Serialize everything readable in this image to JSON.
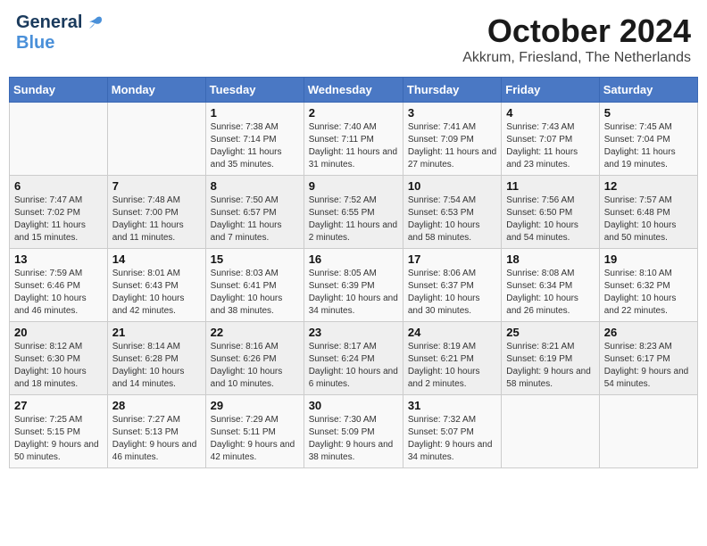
{
  "header": {
    "logo_general": "General",
    "logo_blue": "Blue",
    "main_title": "October 2024",
    "subtitle": "Akkrum, Friesland, The Netherlands"
  },
  "weekdays": [
    "Sunday",
    "Monday",
    "Tuesday",
    "Wednesday",
    "Thursday",
    "Friday",
    "Saturday"
  ],
  "weeks": [
    [
      {
        "day": "",
        "info": ""
      },
      {
        "day": "",
        "info": ""
      },
      {
        "day": "1",
        "info": "Sunrise: 7:38 AM\nSunset: 7:14 PM\nDaylight: 11 hours and 35 minutes."
      },
      {
        "day": "2",
        "info": "Sunrise: 7:40 AM\nSunset: 7:11 PM\nDaylight: 11 hours and 31 minutes."
      },
      {
        "day": "3",
        "info": "Sunrise: 7:41 AM\nSunset: 7:09 PM\nDaylight: 11 hours and 27 minutes."
      },
      {
        "day": "4",
        "info": "Sunrise: 7:43 AM\nSunset: 7:07 PM\nDaylight: 11 hours and 23 minutes."
      },
      {
        "day": "5",
        "info": "Sunrise: 7:45 AM\nSunset: 7:04 PM\nDaylight: 11 hours and 19 minutes."
      }
    ],
    [
      {
        "day": "6",
        "info": "Sunrise: 7:47 AM\nSunset: 7:02 PM\nDaylight: 11 hours and 15 minutes."
      },
      {
        "day": "7",
        "info": "Sunrise: 7:48 AM\nSunset: 7:00 PM\nDaylight: 11 hours and 11 minutes."
      },
      {
        "day": "8",
        "info": "Sunrise: 7:50 AM\nSunset: 6:57 PM\nDaylight: 11 hours and 7 minutes."
      },
      {
        "day": "9",
        "info": "Sunrise: 7:52 AM\nSunset: 6:55 PM\nDaylight: 11 hours and 2 minutes."
      },
      {
        "day": "10",
        "info": "Sunrise: 7:54 AM\nSunset: 6:53 PM\nDaylight: 10 hours and 58 minutes."
      },
      {
        "day": "11",
        "info": "Sunrise: 7:56 AM\nSunset: 6:50 PM\nDaylight: 10 hours and 54 minutes."
      },
      {
        "day": "12",
        "info": "Sunrise: 7:57 AM\nSunset: 6:48 PM\nDaylight: 10 hours and 50 minutes."
      }
    ],
    [
      {
        "day": "13",
        "info": "Sunrise: 7:59 AM\nSunset: 6:46 PM\nDaylight: 10 hours and 46 minutes."
      },
      {
        "day": "14",
        "info": "Sunrise: 8:01 AM\nSunset: 6:43 PM\nDaylight: 10 hours and 42 minutes."
      },
      {
        "day": "15",
        "info": "Sunrise: 8:03 AM\nSunset: 6:41 PM\nDaylight: 10 hours and 38 minutes."
      },
      {
        "day": "16",
        "info": "Sunrise: 8:05 AM\nSunset: 6:39 PM\nDaylight: 10 hours and 34 minutes."
      },
      {
        "day": "17",
        "info": "Sunrise: 8:06 AM\nSunset: 6:37 PM\nDaylight: 10 hours and 30 minutes."
      },
      {
        "day": "18",
        "info": "Sunrise: 8:08 AM\nSunset: 6:34 PM\nDaylight: 10 hours and 26 minutes."
      },
      {
        "day": "19",
        "info": "Sunrise: 8:10 AM\nSunset: 6:32 PM\nDaylight: 10 hours and 22 minutes."
      }
    ],
    [
      {
        "day": "20",
        "info": "Sunrise: 8:12 AM\nSunset: 6:30 PM\nDaylight: 10 hours and 18 minutes."
      },
      {
        "day": "21",
        "info": "Sunrise: 8:14 AM\nSunset: 6:28 PM\nDaylight: 10 hours and 14 minutes."
      },
      {
        "day": "22",
        "info": "Sunrise: 8:16 AM\nSunset: 6:26 PM\nDaylight: 10 hours and 10 minutes."
      },
      {
        "day": "23",
        "info": "Sunrise: 8:17 AM\nSunset: 6:24 PM\nDaylight: 10 hours and 6 minutes."
      },
      {
        "day": "24",
        "info": "Sunrise: 8:19 AM\nSunset: 6:21 PM\nDaylight: 10 hours and 2 minutes."
      },
      {
        "day": "25",
        "info": "Sunrise: 8:21 AM\nSunset: 6:19 PM\nDaylight: 9 hours and 58 minutes."
      },
      {
        "day": "26",
        "info": "Sunrise: 8:23 AM\nSunset: 6:17 PM\nDaylight: 9 hours and 54 minutes."
      }
    ],
    [
      {
        "day": "27",
        "info": "Sunrise: 7:25 AM\nSunset: 5:15 PM\nDaylight: 9 hours and 50 minutes."
      },
      {
        "day": "28",
        "info": "Sunrise: 7:27 AM\nSunset: 5:13 PM\nDaylight: 9 hours and 46 minutes."
      },
      {
        "day": "29",
        "info": "Sunrise: 7:29 AM\nSunset: 5:11 PM\nDaylight: 9 hours and 42 minutes."
      },
      {
        "day": "30",
        "info": "Sunrise: 7:30 AM\nSunset: 5:09 PM\nDaylight: 9 hours and 38 minutes."
      },
      {
        "day": "31",
        "info": "Sunrise: 7:32 AM\nSunset: 5:07 PM\nDaylight: 9 hours and 34 minutes."
      },
      {
        "day": "",
        "info": ""
      },
      {
        "day": "",
        "info": ""
      }
    ]
  ]
}
